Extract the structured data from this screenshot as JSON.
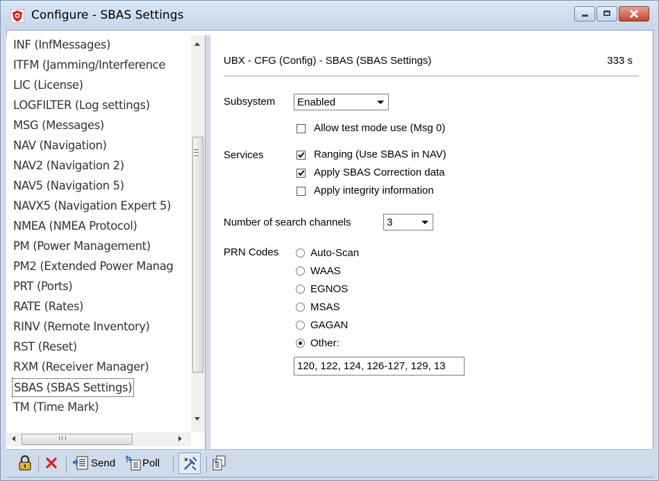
{
  "window": {
    "title": "Configure - SBAS Settings",
    "icon": "red-shield-app-icon",
    "controls": [
      "minimize-icon",
      "maximize-icon",
      "close-icon"
    ]
  },
  "message_list": {
    "items": [
      "INF (InfMessages)",
      "ITFM (Jamming/Interference",
      "LIC (License)",
      "LOGFILTER (Log settings)",
      "MSG (Messages)",
      "NAV (Navigation)",
      "NAV2 (Navigation 2)",
      "NAV5 (Navigation 5)",
      "NAVX5 (Navigation Expert 5)",
      "NMEA (NMEA Protocol)",
      "PM (Power Management)",
      "PM2 (Extended Power Manag",
      "PRT (Ports)",
      "RATE (Rates)",
      "RINV (Remote Inventory)",
      "RST (Reset)",
      "RXM (Receiver Manager)",
      "SBAS (SBAS Settings)",
      "TM (Time Mark)"
    ],
    "selected": "SBAS (SBAS Settings)",
    "hscroll_grip": "III"
  },
  "header": {
    "title": "UBX - CFG (Config) - SBAS (SBAS Settings)",
    "age": "333 s"
  },
  "form": {
    "subsystem_label": "Subsystem",
    "subsystem_value": "Enabled",
    "allow_test_mode_label": "Allow test mode use (Msg 0)",
    "allow_test_mode_checked": false,
    "services_label": "Services",
    "ranging_label": "Ranging (Use SBAS in NAV)",
    "ranging_checked": true,
    "apply_correction_label": "Apply SBAS Correction data",
    "apply_correction_checked": true,
    "apply_integrity_label": "Apply integrity information",
    "apply_integrity_checked": false,
    "search_channels_label": "Number of search channels",
    "search_channels_value": "3",
    "prn_label": "PRN Codes",
    "prn_options": [
      "Auto-Scan",
      "WAAS",
      "EGNOS",
      "MSAS",
      "GAGAN",
      "Other:"
    ],
    "prn_selected": "Other:",
    "prn_other_value": "120, 122, 124, 126-127, 129, 13"
  },
  "toolbar": {
    "send_label": "Send",
    "poll_label": "Poll",
    "icons": [
      "lock-icon",
      "delete-icon",
      "send-icon",
      "poll-icon",
      "tools-icon",
      "copy-icon"
    ]
  },
  "colors": {
    "frame": "#cfdbea",
    "close_button": "#c4442b",
    "delete_x": "#d81e1e",
    "lock": "#e3b51c"
  }
}
